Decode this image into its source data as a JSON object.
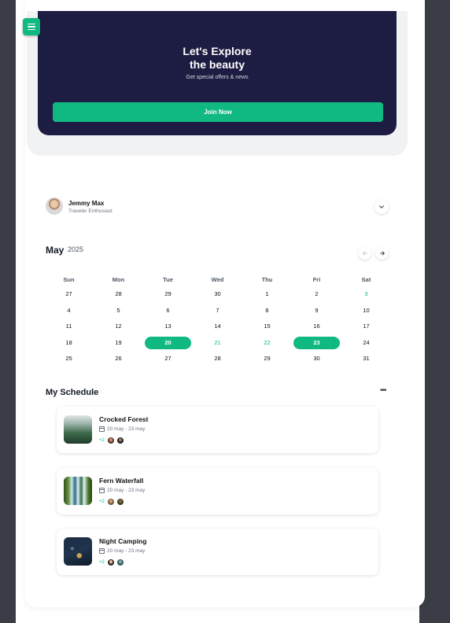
{
  "hero": {
    "title_line1": "Let's Explore",
    "title_line2": "the beauty",
    "subtitle": "Get special offers & news",
    "join_label": "Join Now"
  },
  "profile": {
    "name": "Jemmy Max",
    "role": "Traveler Enthusiast"
  },
  "calendar": {
    "month": "May",
    "year": "2025",
    "weekdays": [
      "Sun",
      "Mon",
      "Tue",
      "Wed",
      "Thu",
      "Fri",
      "Sat"
    ],
    "weeks": [
      [
        "27",
        "28",
        "29",
        "30",
        "1",
        "2",
        "3"
      ],
      [
        "4",
        "5",
        "6",
        "7",
        "8",
        "9",
        "10"
      ],
      [
        "11",
        "12",
        "13",
        "14",
        "15",
        "16",
        "17"
      ],
      [
        "18",
        "19",
        "20",
        "21",
        "22",
        "23",
        "24"
      ],
      [
        "25",
        "26",
        "27",
        "28",
        "29",
        "30",
        "31"
      ]
    ],
    "selected_days": [
      "20",
      "23"
    ],
    "in_range_days": [
      "21",
      "22"
    ],
    "highlighted_days": [
      "3"
    ]
  },
  "schedule": {
    "title": "My Schedule",
    "more_label": "•••",
    "items": [
      {
        "title": "Crocked Forest",
        "dates": "20 may - 23 may",
        "extra": "+2"
      },
      {
        "title": "Fern Waterfall",
        "dates": "20 may - 23 may",
        "extra": "+2"
      },
      {
        "title": "Night Camping",
        "dates": "20 may - 23 may",
        "extra": "+2"
      }
    ]
  },
  "colors": {
    "accent": "#10b981",
    "hero_bg": "#1d1c42",
    "app_bg": "#3a3d45"
  },
  "icons": {
    "menu": "hamburger-icon",
    "profile_toggle": "chevron-down-icon",
    "prev_month": "arrow-left-icon",
    "next_month": "arrow-right-icon",
    "date": "calendar-icon",
    "more": "more-horizontal-icon"
  }
}
